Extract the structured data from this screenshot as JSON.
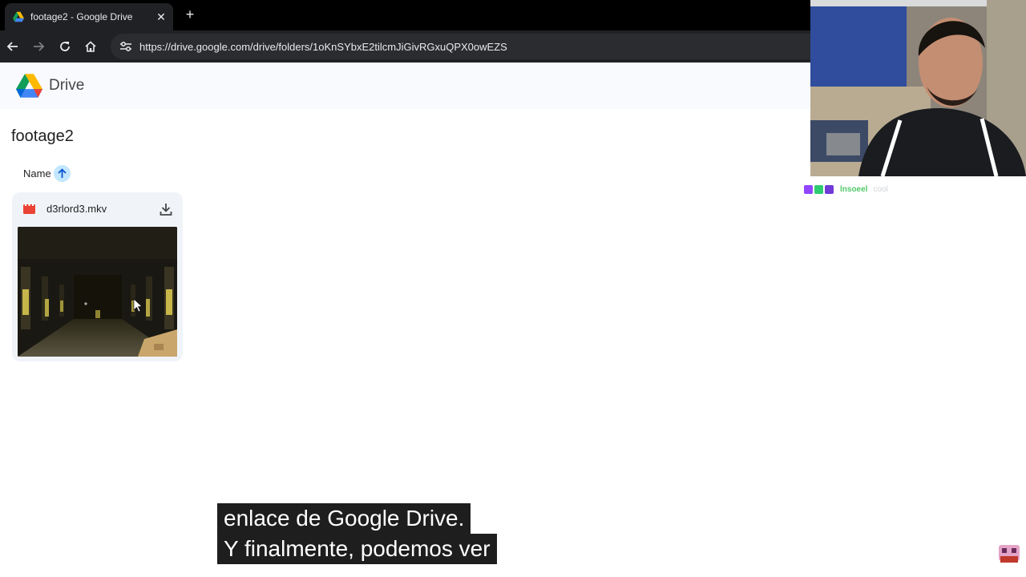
{
  "browser": {
    "tab_title": "footage2 - Google Drive",
    "tab_close": "✕",
    "new_tab": "+",
    "url": "https://drive.google.com/drive/folders/1oKnSYbxE2tilcmJiGivRGxuQPX0owEZS"
  },
  "drive": {
    "app_name": "Drive",
    "folder_name": "footage2",
    "sort_column": "Name",
    "sort_direction": "ascending",
    "files": [
      {
        "name": "d3rlord3.mkv",
        "type": "video",
        "type_color": "#ea4335"
      }
    ]
  },
  "overlay": {
    "chat": {
      "user": "lnsoeel",
      "message": "cool"
    },
    "subtitles": [
      "enlace de Google Drive.",
      "Y finalmente, podemos ver"
    ]
  },
  "icons": {
    "back": "arrow-left-icon",
    "forward": "arrow-right-icon",
    "reload": "reload-icon",
    "home": "home-icon",
    "site_info": "tune-icon",
    "download": "download-icon",
    "sort": "arrow-up-icon"
  }
}
